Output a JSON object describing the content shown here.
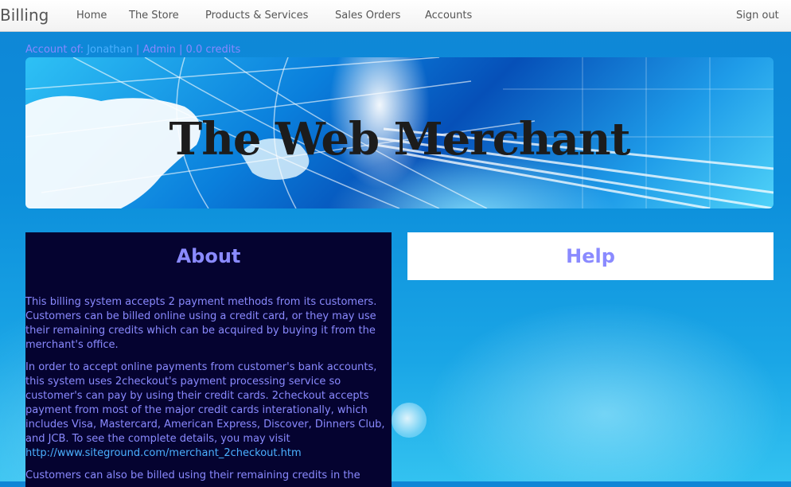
{
  "navbar": {
    "brand": "Billing",
    "items": [
      "Home",
      "The Store",
      "Products & Services",
      "Sales Orders",
      "Accounts"
    ],
    "sign_out": "Sign out"
  },
  "account": {
    "prefix": "Account of:",
    "user": "Jonathan",
    "sep1": "|",
    "role": "Admin",
    "sep2": "|",
    "credits": "0.0 credits"
  },
  "banner": {
    "title": "The Web Merchant"
  },
  "about": {
    "title": "About",
    "p1": "This billing system accepts 2 payment methods from its customers. Customers can be billed online using a credit card, or they may use their remaining credits which can be acquired by buying it from the merchant's office.",
    "p2": "In order to accept online payments from customer's bank accounts, this system uses 2checkout's payment processing service so customer's can pay by using their credit cards. 2checkout accepts payment from most of the major credit cards interationally, which includes Visa, Mastercard, American Express, Discover, Dinners Club, and JCB. To see the complete details, you may visit",
    "link": "http://www.siteground.com/merchant_2checkout.htm",
    "p3": "Customers can also be billed using their remaining credits in the"
  },
  "help": {
    "title": "Help"
  },
  "colors": {
    "panel_text": "#8a8aff",
    "link": "#4ab0ff",
    "about_bg": "#050330"
  }
}
